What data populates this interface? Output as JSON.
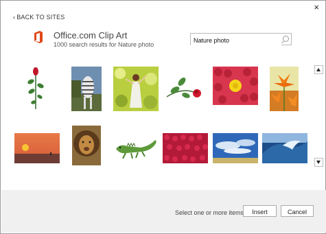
{
  "header": {
    "back_label": "BACK TO SITES",
    "close_label": "×"
  },
  "provider": {
    "title": "Office.com Clip Art",
    "subtitle": "1000 search results for Nature photo",
    "logo_color": "#e0491b"
  },
  "search": {
    "value": "Nature photo",
    "placeholder": ""
  },
  "results": [
    "rose-stem-clipart",
    "zebra-photo",
    "woman-in-flowers-photo",
    "red-rose-clipart",
    "roses-yellow-photo",
    "orange-lilies-photo",
    "sunset-water-photo",
    "lion-photo",
    "iguana-clipart",
    "red-berries-photo",
    "blue-sky-clouds-photo",
    "ocean-wave-photo"
  ],
  "footer": {
    "status": "Select one or more items.",
    "insert_label": "Insert",
    "cancel_label": "Cancel"
  }
}
